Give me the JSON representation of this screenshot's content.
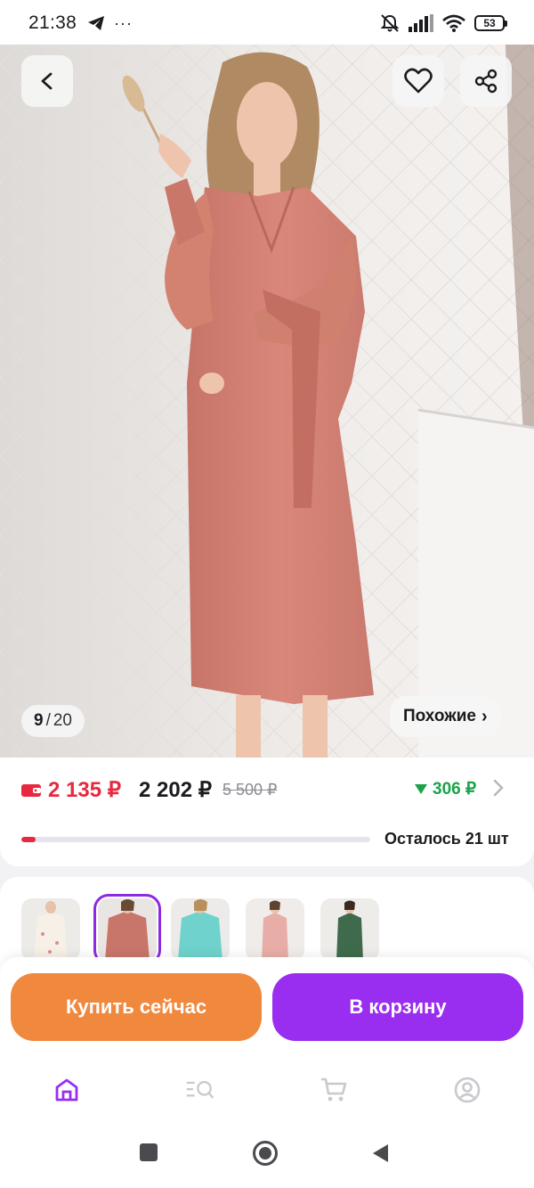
{
  "status_bar": {
    "time": "21:38",
    "battery": "53"
  },
  "product": {
    "image_counter": {
      "current": "9",
      "separator": "/",
      "total": "20"
    },
    "similar_label": "Похожие",
    "similar_chevron": "›",
    "price_wallet": "2 135 ₽",
    "price_current": "2 202 ₽",
    "price_old": "5 500 ₽",
    "discount_amount": "306 ₽",
    "stock_text": "Осталось 21 шт",
    "stock_fraction": 0.04
  },
  "actions": {
    "buy_now": "Купить сейчас",
    "add_to_cart": "В корзину"
  },
  "colors": {
    "accent_purple": "#9a2ef0",
    "buy_orange": "#f0893e",
    "price_red": "#e8283f",
    "discount_green": "#1aa34a"
  }
}
